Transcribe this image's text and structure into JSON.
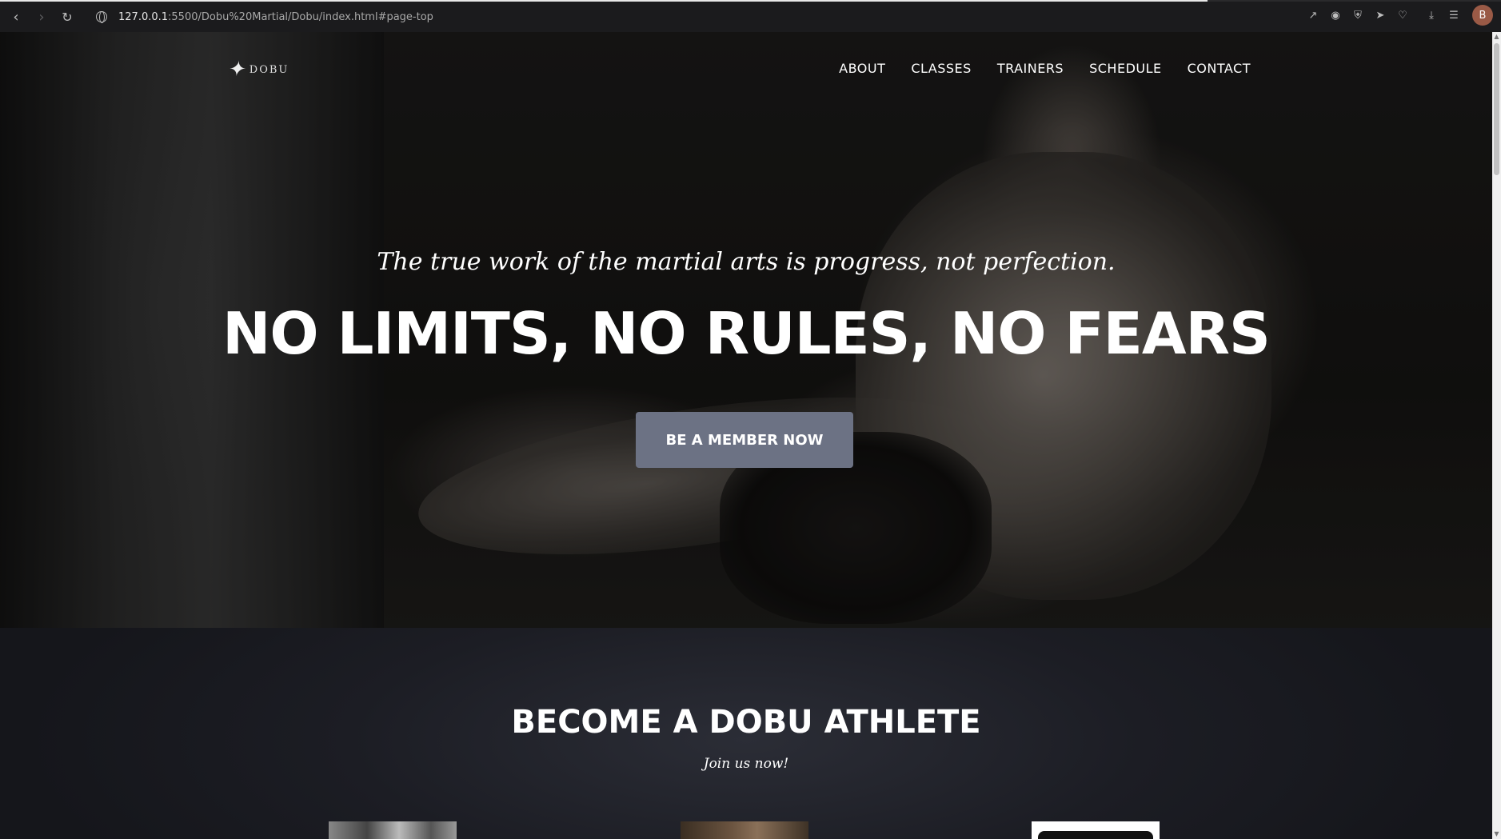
{
  "browser": {
    "url_host": "127.0.0.1",
    "url_path": ":5500/Dobu%20Martial/Dobu/index.html#page-top",
    "profile_initial": "B"
  },
  "site": {
    "logo_text": "DOBU",
    "nav": [
      {
        "label": "ABOUT"
      },
      {
        "label": "CLASSES"
      },
      {
        "label": "TRAINERS"
      },
      {
        "label": "SCHEDULE"
      },
      {
        "label": "CONTACT"
      }
    ]
  },
  "hero": {
    "tagline": "The true work of the martial arts is progress, not perfection.",
    "headline": "NO LIMITS, NO RULES, NO FEARS",
    "cta_label": "BE A MEMBER NOW"
  },
  "section": {
    "title": "BECOME A DOBU ATHLETE",
    "subtitle": "Join us now!"
  },
  "colors": {
    "cta_bg": "#6c7284",
    "section_bg": "#1c1d24",
    "chrome_bg": "#1b1b1d"
  }
}
